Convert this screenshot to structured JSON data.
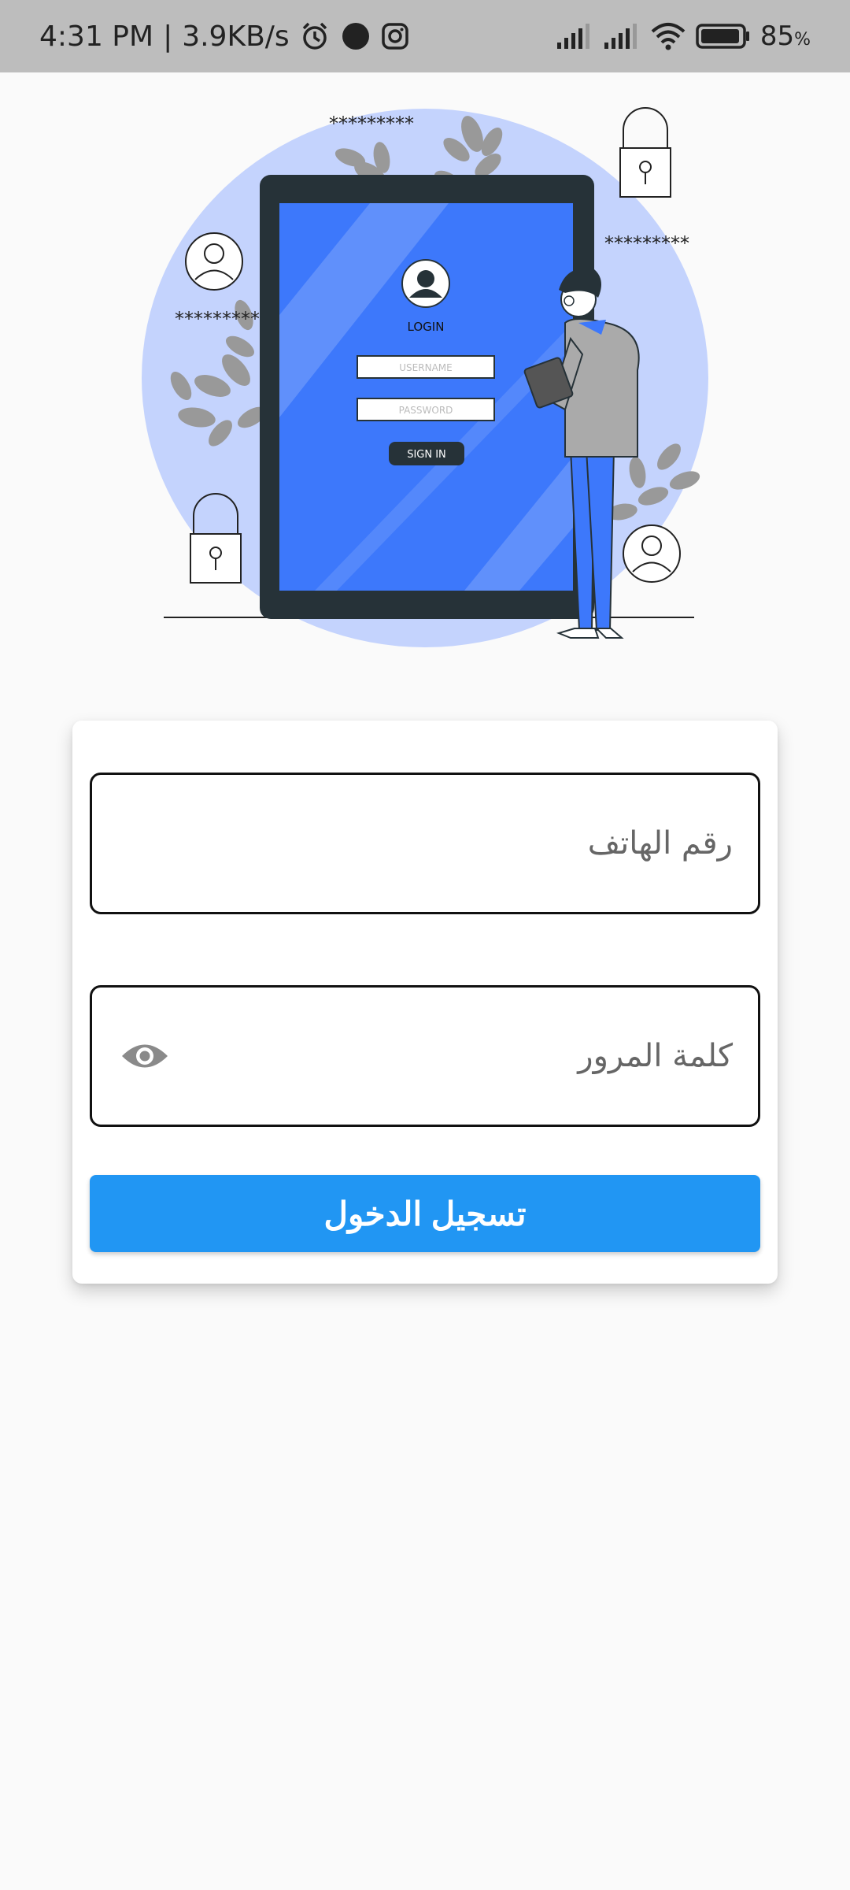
{
  "status_bar": {
    "time": "4:31 PM",
    "network_speed": "3.9KB/s",
    "battery_percent": "85",
    "battery_unit": "%",
    "icons": [
      "alarm-icon",
      "dot-icon",
      "instagram-icon",
      "signal-icon",
      "signal-icon",
      "wifi-icon",
      "battery-icon"
    ]
  },
  "illustration": {
    "screen_title": "LOGIN",
    "username_placeholder": "USERNAME",
    "password_placeholder": "PASSWORD",
    "sign_in_label": "SIGN IN",
    "asterisks": "*********"
  },
  "form": {
    "phone_placeholder": "رقم الهاتف",
    "password_placeholder": "كلمة المرور",
    "login_label": "تسجيل الدخول",
    "eye_icon": "eye-icon"
  },
  "colors": {
    "status_bar_bg": "#bdbdbd",
    "primary_button": "#2196f3",
    "tablet_screen": "#3d78fb",
    "blob": "#c4d3fd"
  }
}
